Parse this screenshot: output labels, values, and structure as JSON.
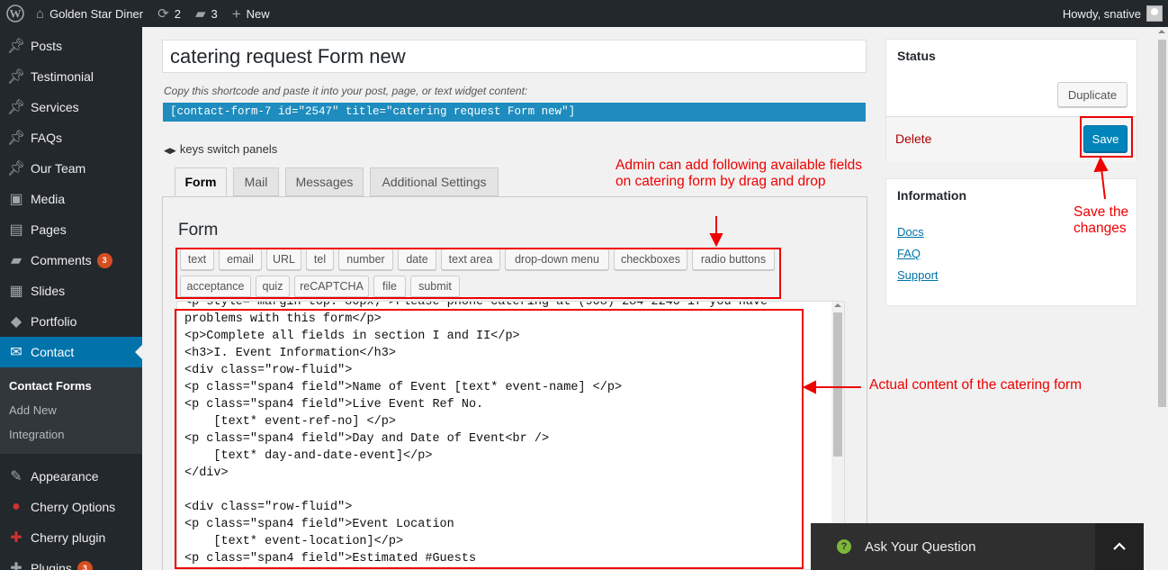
{
  "adminbar": {
    "site_name": "Golden Star Diner",
    "updates_count": "2",
    "comments_count": "3",
    "new_label": "New",
    "howdy": "Howdy, snative"
  },
  "sidebar": {
    "items": [
      {
        "label": "Posts",
        "icon": "pin-icon"
      },
      {
        "label": "Testimonial",
        "icon": "pin-icon"
      },
      {
        "label": "Services",
        "icon": "pin-icon"
      },
      {
        "label": "FAQs",
        "icon": "pin-icon"
      },
      {
        "label": "Our Team",
        "icon": "pin-icon"
      },
      {
        "label": "Media",
        "icon": "media-icon"
      },
      {
        "label": "Pages",
        "icon": "pages-icon"
      },
      {
        "label": "Comments",
        "icon": "comment-icon",
        "badge": "3"
      },
      {
        "label": "Slides",
        "icon": "slides-icon"
      },
      {
        "label": "Portfolio",
        "icon": "portfolio-icon"
      },
      {
        "label": "Contact",
        "icon": "mail-icon"
      }
    ],
    "submenu": [
      "Contact Forms",
      "Add New",
      "Integration"
    ],
    "items_after": [
      {
        "label": "Appearance",
        "icon": "brush-icon"
      },
      {
        "label": "Cherry Options",
        "icon": "cherry-icon"
      },
      {
        "label": "Cherry plugin",
        "icon": "plugin-icon"
      },
      {
        "label": "Plugins",
        "icon": "plugin-icon",
        "badge": "3"
      }
    ]
  },
  "editor": {
    "title": "catering request Form new",
    "shortcode_label": "Copy this shortcode and paste it into your post, page, or text widget content:",
    "shortcode": "[contact-form-7 id=\"2547\" title=\"catering request Form new\"]",
    "keys_switch": "keys switch panels",
    "tabs": [
      "Form",
      "Mail",
      "Messages",
      "Additional Settings"
    ],
    "form_heading": "Form",
    "tag_buttons_row1": [
      "text",
      "email",
      "URL",
      "tel",
      "number",
      "date",
      "text area",
      "drop-down menu",
      "checkboxes",
      "radio buttons"
    ],
    "tag_buttons_row2": [
      "acceptance",
      "quiz",
      "reCAPTCHA",
      "file",
      "submit"
    ],
    "code": "<p style=\"margin-top: 80px;\">Please phone catering at (908) 284-2240 if you have\nproblems with this form</p>\n<p>Complete all fields in section I and II</p>\n<h3>I. Event Information</h3>\n<div class=\"row-fluid\">\n<p class=\"span4 field\">Name of Event [text* event-name] </p>\n<p class=\"span4 field\">Live Event Ref No.\n    [text* event-ref-no] </p>\n<p class=\"span4 field\">Day and Date of Event<br />\n    [text* day-and-date-event]</p>\n</div>\n\n<div class=\"row-fluid\">\n<p class=\"span4 field\">Event Location\n    [text* event-location]</p>\n<p class=\"span4 field\">Estimated #Guests"
  },
  "status_box": {
    "title": "Status",
    "duplicate": "Duplicate",
    "delete": "Delete",
    "save": "Save"
  },
  "info_box": {
    "title": "Information",
    "links": [
      "Docs",
      "FAQ",
      "Support"
    ]
  },
  "annotations": {
    "fields_note_line1": "Admin can add following available fields",
    "fields_note_line2": "on catering form by drag and drop",
    "save_note_line1": "Save the",
    "save_note_line2": "changes",
    "content_note": "Actual content of the catering form"
  },
  "ask_widget": {
    "label": "Ask Your Question"
  },
  "colors": {
    "adminbar_bg": "#23282d",
    "accent": "#0073aa",
    "annotation": "#ee0000",
    "shortcode_bg": "#1e8cbe"
  }
}
